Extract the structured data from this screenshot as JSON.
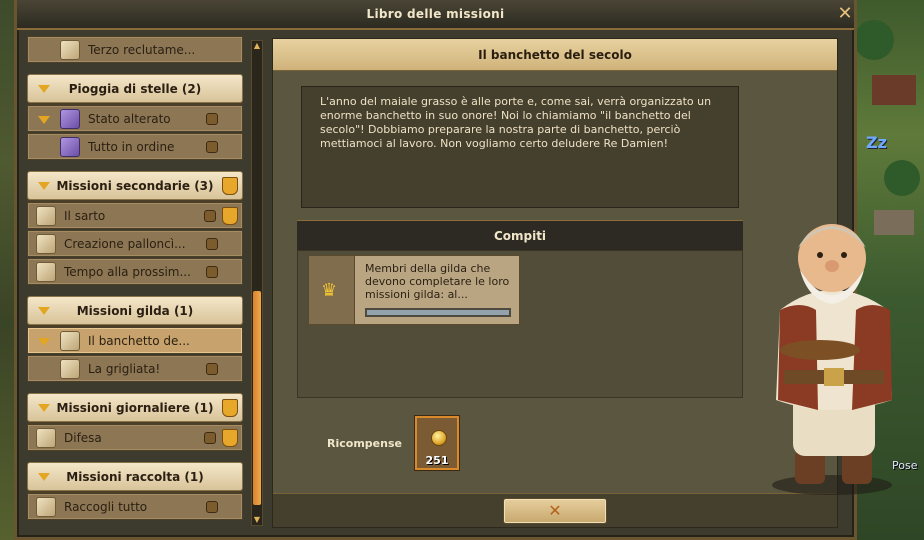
{
  "window": {
    "title": "Libro delle missioni",
    "close_label": "✕"
  },
  "background": {
    "zz_text": "Zz",
    "pose_text": "Pose"
  },
  "quest_list": [
    {
      "kind": "item",
      "label": "Terzo reclutame...",
      "icon": "scroll-icon",
      "lock": false,
      "cup": false,
      "selected": false
    },
    {
      "kind": "category",
      "label": "Pioggia di stelle (2)",
      "cup": false
    },
    {
      "kind": "item",
      "label": "Stato alterato",
      "icon": "star-spell-icon",
      "lock": true,
      "cup": false,
      "selected": false,
      "arrow": true
    },
    {
      "kind": "item",
      "label": "Tutto in ordine",
      "icon": "star-spell-icon",
      "lock": true,
      "cup": false,
      "selected": false
    },
    {
      "kind": "category",
      "label": "Missioni secondarie (3)",
      "cup": true
    },
    {
      "kind": "item",
      "label": "Il sarto",
      "icon": "scroll-icon",
      "lock": true,
      "cup": true,
      "selected": false
    },
    {
      "kind": "item",
      "label": "Creazione palloncì...",
      "icon": "scroll-icon",
      "lock": true,
      "cup": false,
      "selected": false
    },
    {
      "kind": "item",
      "label": "Tempo alla prossim...",
      "icon": "scroll-icon",
      "lock": true,
      "cup": false,
      "selected": false
    },
    {
      "kind": "category",
      "label": "Missioni gilda (1)",
      "cup": false
    },
    {
      "kind": "item",
      "label": "Il banchetto de...",
      "icon": "guild-scroll-icon",
      "lock": false,
      "cup": false,
      "selected": true,
      "arrow": true
    },
    {
      "kind": "item",
      "label": "La grigliata!",
      "icon": "guild-scroll-icon",
      "lock": true,
      "cup": false,
      "selected": false
    },
    {
      "kind": "category",
      "label": "Missioni giornaliere (1)",
      "cup": true
    },
    {
      "kind": "item",
      "label": "Difesa",
      "icon": "daily-scroll-icon",
      "lock": true,
      "cup": true,
      "selected": false
    },
    {
      "kind": "category",
      "label": "Missioni raccolta (1)",
      "cup": false
    },
    {
      "kind": "item",
      "label": "Raccogli tutto",
      "icon": "daily-scroll-icon",
      "lock": true,
      "cup": false,
      "selected": false
    }
  ],
  "detail": {
    "title": "Il banchetto del secolo",
    "description": "L'anno del maiale grasso è alle porte e, come sai, verrà organizzato un enorme banchetto in suo onore! Noi lo chiamiamo \"il banchetto del secolo\"! Dobbiamo preparare la nostra parte di banchetto, perciò mettiamoci al lavoro. Non vogliamo certo deludere Re Damien!",
    "tasks_title": "Compiti",
    "task": {
      "text": "Membri della gilda che devono completare le loro missioni gilda: al...",
      "icon": "crown-icon",
      "progress": 0.0
    },
    "rewards_label": "Ricompense",
    "reward": {
      "icon": "gold-coin-icon",
      "value": "251"
    },
    "ok_label": "✕"
  },
  "colors": {
    "accent": "#e3a623",
    "frame": "#6a5531",
    "selected_item": "#c7a26c"
  }
}
